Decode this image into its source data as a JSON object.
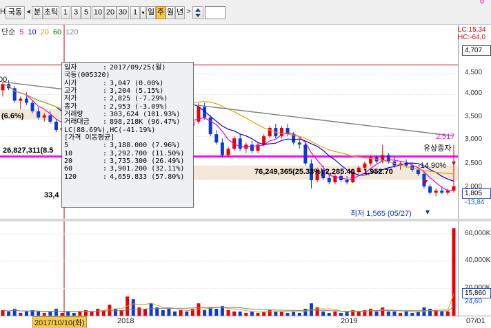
{
  "toolbar": {
    "stock_name": "국동",
    "minute": "분",
    "tick": "초틱",
    "periods": [
      "1",
      "3",
      "5",
      "10",
      "20",
      "30"
    ],
    "blank_button": "1",
    "day": "일",
    "week": "주",
    "month": "월",
    "year": "년",
    "prev": "◂",
    "next": ">"
  },
  "legend": {
    "prefix": "단순",
    "ma_periods": [
      "5",
      "10",
      "20",
      "60",
      "120"
    ],
    "ma_colors": [
      "#e000e0",
      "#0000e0",
      "#e0a000",
      "#008000",
      "#808080"
    ],
    "lc": "LC:15,34",
    "hc": "HC:-64,0"
  },
  "price_axis": {
    "labels": [
      "4,500",
      "4,000",
      "3,500",
      "3,000",
      "2,500",
      "2,000"
    ],
    "current_box": "4,707",
    "last_price_box": "1,805",
    "last_change": "-13,84"
  },
  "volume_axis": {
    "labels": [
      "60,000K",
      "40,000K",
      "20,000K"
    ],
    "current_box": "15,860",
    "sub": "24,60"
  },
  "date_axis": {
    "cursor_date": "2017/10/10(화)",
    "labels": [
      "2018",
      "2019",
      "07/01"
    ]
  },
  "tooltip": {
    "date_label": "일자",
    "date_value": "2017/09/25(월)",
    "name": "국동(005320)",
    "rows": [
      {
        "k": "시가",
        "v": "3,047 (0.00%)"
      },
      {
        "k": "고가",
        "v": "3,204 (5.15%)"
      },
      {
        "k": "저가",
        "v": "2,825 (-7.29%)"
      },
      {
        "k": "종가",
        "v": "2,953 (-3.09%)"
      },
      {
        "k": "거래량",
        "v": "303,624 (101.93%)"
      },
      {
        "k": "거래대금",
        "v": "898,218K (96.47%)"
      }
    ],
    "lc_hc": "LC(88.69%),HC(-41.19%)",
    "ma_header": "[가격 이동평균]",
    "ma_rows": [
      {
        "k": "5",
        "v": "3,188.000 (7.96%)"
      },
      {
        "k": "10",
        "v": "3,292.700 (11.50%)"
      },
      {
        "k": "20",
        "v": "3,735.300 (26.49%)"
      },
      {
        "k": "60",
        "v": "3,901.200 (32.11%)"
      },
      {
        "k": "120",
        "v": "4,659.833 (57.80%)"
      }
    ]
  },
  "annotations": {
    "pct_left": "(6.6%)",
    "vol_left": "26,827,311(8.5",
    "num_33": "33,4",
    "range_text": "76,249,365(25.33%) 2,285.40 ~ 1,952.70",
    "pct_right": "-14.90%",
    "line_value": "2,517",
    "line_label": "유상증자",
    "lowest": "최저 1,565 (05/27)",
    "partial_left": "00"
  },
  "colors": {
    "up": "#e8000a",
    "down": "#0a3bd6",
    "magenta": "#ff00ff",
    "band": "#f5e8d6"
  },
  "chart_data": {
    "type": "candlestick",
    "note_series": "weekly OHLC, approximate",
    "ylim": [
      1500,
      4800
    ],
    "candles": [
      [
        4100,
        4300,
        3950,
        4250
      ],
      [
        4250,
        4350,
        4100,
        4150
      ],
      [
        4150,
        4200,
        3800,
        3850
      ],
      [
        3850,
        3950,
        3650,
        3900
      ],
      [
        3900,
        4050,
        3750,
        3800
      ],
      [
        3800,
        3850,
        3550,
        3600
      ],
      [
        3600,
        3700,
        3400,
        3450
      ],
      [
        3450,
        3550,
        3350,
        3500
      ],
      [
        3500,
        3600,
        3300,
        3350
      ],
      [
        3350,
        3400,
        3100,
        3150
      ],
      [
        3150,
        3250,
        2950,
        3200
      ],
      [
        3200,
        3300,
        3050,
        3100
      ],
      [
        3047,
        3204,
        2825,
        2953
      ],
      [
        2950,
        3150,
        2900,
        3100
      ],
      [
        3100,
        3300,
        3000,
        3250
      ],
      [
        3250,
        3400,
        3150,
        3350
      ],
      [
        3350,
        3600,
        3300,
        3550
      ],
      [
        3550,
        3900,
        3500,
        3850
      ],
      [
        3850,
        4200,
        3800,
        4100
      ],
      [
        4100,
        4300,
        3950,
        4050
      ],
      [
        4050,
        4300,
        4000,
        4250
      ],
      [
        4250,
        4707,
        4200,
        4400
      ],
      [
        4400,
        4500,
        4150,
        4200
      ],
      [
        4200,
        4450,
        4100,
        4350
      ],
      [
        4350,
        4600,
        4300,
        4550
      ],
      [
        4550,
        4600,
        4200,
        4250
      ],
      [
        4250,
        4350,
        3950,
        4000
      ],
      [
        4000,
        4100,
        3650,
        3700
      ],
      [
        3700,
        3800,
        3400,
        3450
      ],
      [
        3450,
        3600,
        3300,
        3350
      ],
      [
        3350,
        3500,
        3250,
        3450
      ],
      [
        3450,
        3550,
        3200,
        3250
      ],
      [
        3250,
        3400,
        3150,
        3350
      ],
      [
        3350,
        3800,
        3300,
        3700
      ],
      [
        3700,
        3800,
        3400,
        3450
      ],
      [
        3450,
        3500,
        3000,
        3050
      ],
      [
        3050,
        3150,
        2800,
        2850
      ],
      [
        2850,
        2950,
        2500,
        2550
      ],
      [
        2550,
        2750,
        2500,
        2700
      ],
      [
        2700,
        3000,
        2650,
        2950
      ],
      [
        2950,
        3050,
        2650,
        2700
      ],
      [
        2700,
        2850,
        2600,
        2800
      ],
      [
        2800,
        2900,
        2600,
        2650
      ],
      [
        2650,
        2850,
        2600,
        2800
      ],
      [
        2800,
        3050,
        2750,
        3000
      ],
      [
        3000,
        3250,
        2950,
        3200
      ],
      [
        3200,
        3300,
        2950,
        3000
      ],
      [
        3000,
        3250,
        2950,
        3200
      ],
      [
        3200,
        3300,
        3000,
        3050
      ],
      [
        3050,
        3100,
        2800,
        2850
      ],
      [
        2850,
        2950,
        2700,
        2800
      ],
      [
        2800,
        2850,
        2300,
        2350
      ],
      [
        2350,
        2450,
        1750,
        1950
      ],
      [
        1950,
        2250,
        1900,
        2200
      ],
      [
        2200,
        2300,
        1950,
        2000
      ],
      [
        2000,
        2100,
        1850,
        1900
      ],
      [
        1900,
        2100,
        1850,
        2050
      ],
      [
        2050,
        2150,
        1900,
        1950
      ],
      [
        1950,
        2050,
        1850,
        1900
      ],
      [
        1900,
        2200,
        1880,
        2150
      ],
      [
        2150,
        2300,
        2100,
        2250
      ],
      [
        2250,
        2400,
        2200,
        2350
      ],
      [
        2350,
        2550,
        2300,
        2500
      ],
      [
        2500,
        2550,
        2350,
        2400
      ],
      [
        2400,
        2800,
        2350,
        2550
      ],
      [
        2550,
        2600,
        2350,
        2400
      ],
      [
        2400,
        2500,
        2250,
        2300
      ],
      [
        2300,
        2400,
        2200,
        2350
      ],
      [
        2350,
        2450,
        2250,
        2300
      ],
      [
        2300,
        2350,
        2150,
        2200
      ],
      [
        2200,
        2250,
        2050,
        2100
      ],
      [
        2100,
        2150,
        1750,
        1800
      ],
      [
        1800,
        1850,
        1600,
        1650
      ],
      [
        1650,
        1750,
        1565,
        1700
      ],
      [
        1700,
        1800,
        1620,
        1650
      ],
      [
        1650,
        1750,
        1600,
        1700
      ],
      [
        1700,
        2800,
        1650,
        1805
      ]
    ],
    "volumes": [
      4,
      3,
      5,
      2,
      3,
      4,
      3,
      2,
      3,
      5,
      2,
      3,
      2,
      3,
      4,
      3,
      5,
      4,
      8,
      5,
      4,
      14,
      12,
      6,
      5,
      9,
      6,
      4,
      5,
      3,
      4,
      3,
      5,
      9,
      4,
      6,
      5,
      7,
      4,
      3,
      3,
      2,
      3,
      2,
      3,
      4,
      3,
      3,
      2,
      3,
      2,
      5,
      9,
      6,
      3,
      2,
      3,
      2,
      3,
      4,
      3,
      4,
      5,
      3,
      6,
      3,
      3,
      2,
      3,
      2,
      3,
      6,
      5,
      4,
      3,
      3,
      64
    ]
  }
}
